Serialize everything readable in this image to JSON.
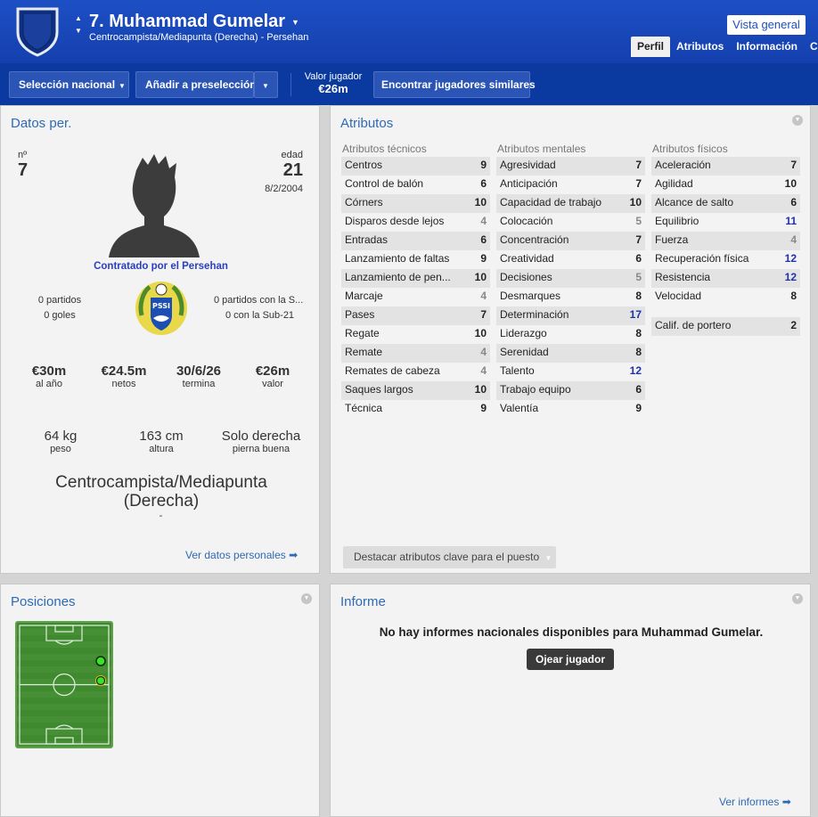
{
  "header": {
    "name": "7. Muhammad Gumelar",
    "subtitle": "Centrocampista/Mediapunta (Derecha) - Persehan",
    "vista_general": "Vista general",
    "tabs": [
      "Perfil",
      "Atributos",
      "Información",
      "Ch"
    ]
  },
  "toolbar": {
    "seleccion": "Selección nacional",
    "preseleccion": "Añadir a preselección",
    "valor_label": "Valor jugador",
    "valor": "€26m",
    "similares": "Encontrar jugadores similares"
  },
  "datos": {
    "title": "Datos per.",
    "num_label": "nº",
    "num": "7",
    "edad_label": "edad",
    "edad": "21",
    "nacimiento": "8/2/2004",
    "contrato": "Contratado por el Persehan",
    "partidos": "0 partidos",
    "goles": "0 goles",
    "partidos_sub": "0 partidos con la S...",
    "goles_sub": "0 con la Sub-21",
    "salario": "€30m",
    "salario_lbl": "al año",
    "netos": "€24.5m",
    "netos_lbl": "netos",
    "termina": "30/6/26",
    "termina_lbl": "termina",
    "valor": "€26m",
    "valor_lbl": "valor",
    "peso": "64 kg",
    "peso_lbl": "peso",
    "altura": "163 cm",
    "altura_lbl": "altura",
    "pierna": "Solo derecha",
    "pierna_lbl": "pierna buena",
    "posicion": "Centrocampista/Mediapunta (Derecha)",
    "posicion_extra": "-",
    "ver_datos": "Ver datos personales ➡"
  },
  "atributos": {
    "title": "Atributos",
    "tecnicos_title": "Atributos técnicos",
    "tecnicos": [
      {
        "n": "Centros",
        "v": "9"
      },
      {
        "n": "Control de balón",
        "v": "6"
      },
      {
        "n": "Córners",
        "v": "10"
      },
      {
        "n": "Disparos desde lejos",
        "v": "4"
      },
      {
        "n": "Entradas",
        "v": "6"
      },
      {
        "n": "Lanzamiento de faltas",
        "v": "9"
      },
      {
        "n": "Lanzamiento de pen...",
        "v": "10"
      },
      {
        "n": "Marcaje",
        "v": "4"
      },
      {
        "n": "Pases",
        "v": "7"
      },
      {
        "n": "Regate",
        "v": "10"
      },
      {
        "n": "Remate",
        "v": "4"
      },
      {
        "n": "Remates de cabeza",
        "v": "4"
      },
      {
        "n": "Saques largos",
        "v": "10"
      },
      {
        "n": "Técnica",
        "v": "9"
      }
    ],
    "mentales_title": "Atributos mentales",
    "mentales": [
      {
        "n": "Agresividad",
        "v": "7"
      },
      {
        "n": "Anticipación",
        "v": "7"
      },
      {
        "n": "Capacidad de trabajo",
        "v": "10"
      },
      {
        "n": "Colocación",
        "v": "5"
      },
      {
        "n": "Concentración",
        "v": "7"
      },
      {
        "n": "Creatividad",
        "v": "6"
      },
      {
        "n": "Decisiones",
        "v": "5"
      },
      {
        "n": "Desmarques",
        "v": "8"
      },
      {
        "n": "Determinación",
        "v": "17"
      },
      {
        "n": "Liderazgo",
        "v": "8"
      },
      {
        "n": "Serenidad",
        "v": "8"
      },
      {
        "n": "Talento",
        "v": "12"
      },
      {
        "n": "Trabajo equipo",
        "v": "6"
      },
      {
        "n": "Valentía",
        "v": "9"
      }
    ],
    "fisicos_title": "Atributos físicos",
    "fisicos": [
      {
        "n": "Aceleración",
        "v": "7"
      },
      {
        "n": "Agilidad",
        "v": "10"
      },
      {
        "n": "Alcance de salto",
        "v": "6"
      },
      {
        "n": "Equilibrio",
        "v": "11"
      },
      {
        "n": "Fuerza",
        "v": "4"
      },
      {
        "n": "Recuperación física",
        "v": "12"
      },
      {
        "n": "Resistencia",
        "v": "12"
      },
      {
        "n": "Velocidad",
        "v": "8"
      }
    ],
    "portero_label": "Calif. de portero",
    "portero": "2",
    "destacar": "Destacar atributos clave para el puesto"
  },
  "posiciones": {
    "title": "Posiciones"
  },
  "informe": {
    "title": "Informe",
    "mensaje": "No hay informes nacionales disponibles para Muhammad Gumelar.",
    "ojear": "Ojear jugador",
    "ver_informes": "Ver informes ➡"
  }
}
